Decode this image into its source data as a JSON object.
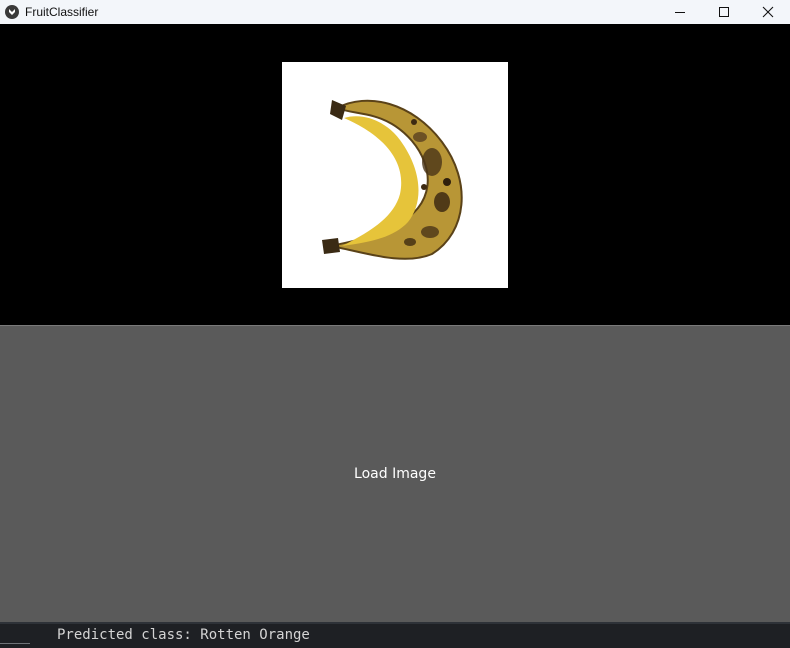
{
  "window": {
    "title": "FruitClassifier",
    "app_icon": "kivy-logo-icon",
    "controls": [
      "minimize-icon",
      "maximize-icon",
      "close-icon"
    ]
  },
  "image_panel": {
    "content": "banana-photo",
    "background": "#000000"
  },
  "load_button": {
    "label": "Load Image",
    "background": "#5a5a5a"
  },
  "status": {
    "text": "Predicted class: Rotten Orange"
  }
}
